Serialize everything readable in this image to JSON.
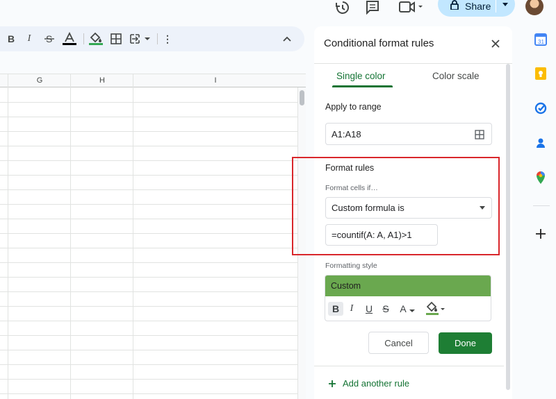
{
  "header": {
    "share_label": "Share",
    "icons": [
      "history-icon",
      "comment-icon",
      "meet-icon",
      "lock-icon",
      "avatar"
    ]
  },
  "toolbar": {
    "buttons": [
      {
        "name": "bold-button",
        "glyph": "B"
      },
      {
        "name": "italic-button",
        "glyph": "I"
      },
      {
        "name": "strikethrough-button",
        "glyph": "S"
      },
      {
        "name": "text-color-button",
        "glyph": "A"
      },
      {
        "name": "fill-color-button",
        "icon": "paint-bucket-icon"
      },
      {
        "name": "borders-button",
        "icon": "borders-icon"
      },
      {
        "name": "merge-cells-button",
        "icon": "merge-icon"
      },
      {
        "name": "more-options-button",
        "glyph": "⋮"
      },
      {
        "name": "collapse-toolbar-button",
        "icon": "chevron-up-icon"
      }
    ]
  },
  "grid": {
    "columns": [
      "G",
      "H",
      "I"
    ]
  },
  "panel": {
    "title": "Conditional format rules",
    "tabs": [
      {
        "label": "Single color",
        "active": true
      },
      {
        "label": "Color scale",
        "active": false
      }
    ],
    "apply_to_range": {
      "label": "Apply to range",
      "value": "A1:A18"
    },
    "format_rules": {
      "label": "Format rules",
      "condition_label": "Format cells if…",
      "condition_value": "Custom formula is",
      "formula_value": "=countif(A: A, A1)>1"
    },
    "formatting_style": {
      "label": "Formatting style",
      "preview_text": "Custom",
      "preview_fill": "#6aa84f",
      "buttons": [
        "B",
        "I",
        "U",
        "S",
        "A"
      ]
    },
    "cancel_label": "Cancel",
    "done_label": "Done",
    "add_rule_label": "Add another rule"
  },
  "side_apps": [
    "calendar-icon",
    "keep-icon",
    "tasks-icon",
    "contacts-icon",
    "maps-icon",
    "add-icon"
  ],
  "colors": {
    "accent_green": "#137333",
    "done_button": "#1e7e34",
    "highlight_red": "#d9262b",
    "share_blue": "#c2e7ff"
  }
}
